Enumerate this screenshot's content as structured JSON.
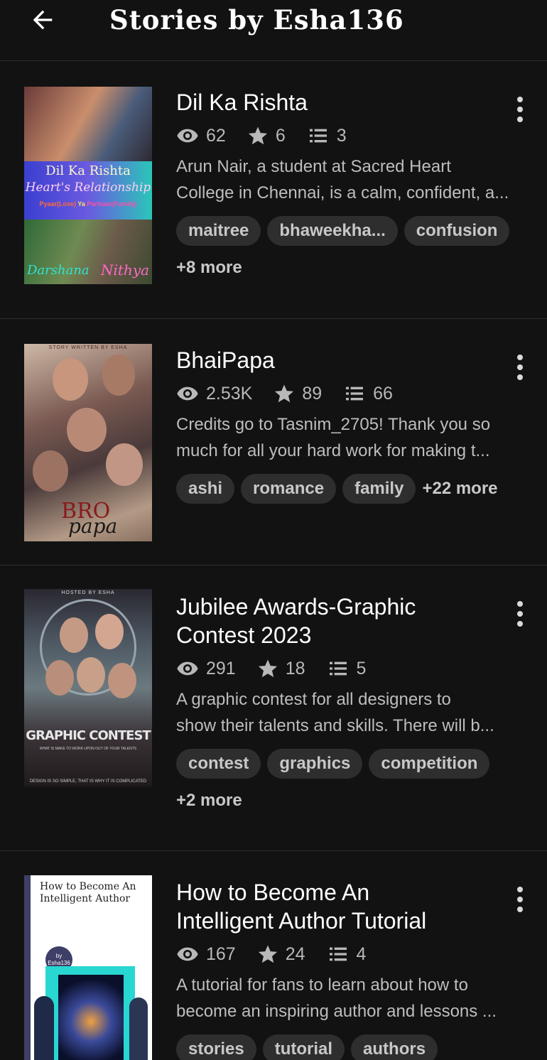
{
  "header": {
    "title": "Stories by Esha136"
  },
  "stories": [
    {
      "title": [
        "Dil Ka Rishta"
      ],
      "views": "62",
      "votes": "6",
      "parts": "3",
      "description": [
        "Arun Nair, a student at Sacred Heart",
        "College in Chennai, is a calm, confident, a..."
      ],
      "tags": [
        "maitree",
        "bhaweekha...",
        "confusion"
      ],
      "more": "+8 more",
      "cover": {
        "line1": "Dil Ka Rishta",
        "line2": "Heart's Relationship",
        "line3a": "Pyaar(Love)",
        "line3b": "Ya",
        "line3c": "Parivaar(Family)",
        "name1": "Darshana",
        "name2": "Nithya"
      }
    },
    {
      "title": [
        "BhaiPapa"
      ],
      "views": "2.53K",
      "votes": "89",
      "parts": "66",
      "description": [
        "Credits go to Tasnim_2705! Thank you so",
        "much for all your hard work for making t..."
      ],
      "tags": [
        "ashi",
        "romance",
        "family"
      ],
      "more": "+22 more",
      "cover": {
        "top": "STORY WRITTEN BY ESHA",
        "word1": "BRO",
        "word2": "papa"
      }
    },
    {
      "title": [
        "Jubilee Awards-Graphic",
        "Contest 2023"
      ],
      "views": "291",
      "votes": "18",
      "parts": "5",
      "description": [
        "A graphic contest for all designers to",
        "show their talents and skills. There will b..."
      ],
      "tags": [
        "contest",
        "graphics",
        "competition"
      ],
      "more": "+2 more",
      "cover": {
        "top": "HOSTED BY ESHA",
        "main": "GRAPHIC CONTEST",
        "sub": "WHAT IS MAKE TO WORK UPON OUT OF YOUR TALENTS",
        "bottom": "DESIGN IS SO SIMPLE, THAT IS WHY IT IS COMPLICATED"
      }
    },
    {
      "title": [
        "How to Become An",
        "Intelligent Author Tutorial"
      ],
      "views": "167",
      "votes": "24",
      "parts": "4",
      "description": [
        "A tutorial for fans to learn about how to",
        "become an inspiring author and lessons ..."
      ],
      "tags": [
        "stories",
        "tutorial",
        "authors"
      ],
      "more": "",
      "cover": {
        "line1": "How to Become An",
        "line2": "Intelligent Author",
        "by": "by",
        "author": "Esha136"
      }
    }
  ],
  "colors": {
    "background": "#121212",
    "tag_bg": "#2e2e2e",
    "meta": "#b8b8b8"
  },
  "icons": {
    "back": "arrow-left-icon",
    "views": "eye-icon",
    "votes": "star-icon",
    "parts": "list-icon",
    "menu": "kebab-menu-icon"
  }
}
